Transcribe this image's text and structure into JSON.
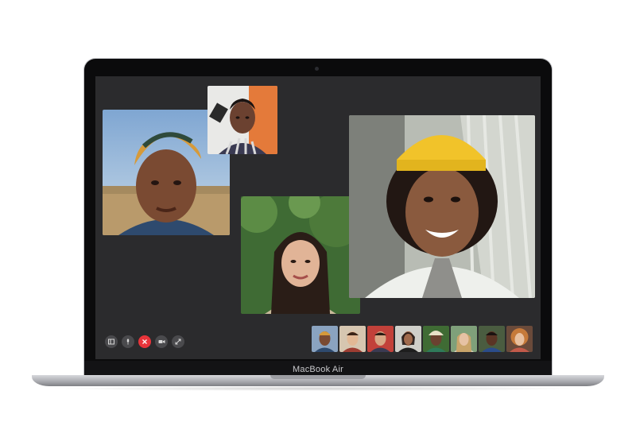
{
  "device": {
    "brand_label": "MacBook Air"
  },
  "call": {
    "participants": [
      {
        "name": "participant-headwrap",
        "tile": "large"
      },
      {
        "name": "participant-striped-shirt",
        "tile": "small"
      },
      {
        "name": "participant-long-hair",
        "tile": "medium"
      },
      {
        "name": "participant-yellow-beanie",
        "tile": "featured"
      }
    ],
    "controls": [
      {
        "icon": "sidebar-icon",
        "color": "#4a4a4d"
      },
      {
        "icon": "microphone-icon",
        "color": "#4a4a4d"
      },
      {
        "icon": "close-icon",
        "color": "#e8343a"
      },
      {
        "icon": "video-camera-icon",
        "color": "#4a4a4d"
      },
      {
        "icon": "fullscreen-icon",
        "color": "#4a4a4d"
      }
    ],
    "roster_count": 8
  },
  "colors": {
    "screen_bg": "#2b2b2d",
    "end_call": "#e8343a"
  }
}
